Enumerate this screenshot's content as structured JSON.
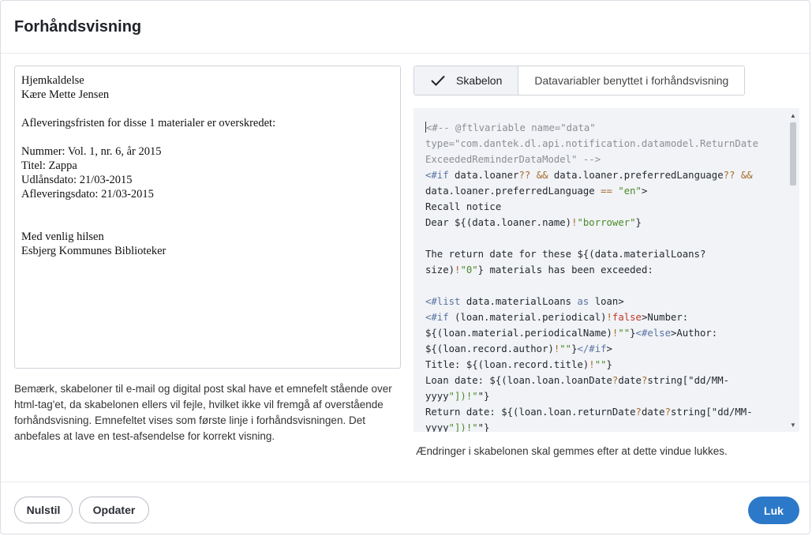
{
  "dialog": {
    "title": "Forhåndsvisning"
  },
  "preview": {
    "lines": [
      "Hjemkaldelse",
      "Kære Mette Jensen",
      "",
      "Afleveringsfristen for disse 1 materialer er overskredet:",
      "",
      "Nummer: Vol. 1, nr. 6, år 2015",
      "Titel: Zappa",
      "Udlånsdato: 21/03-2015",
      "Afleveringsdato: 21/03-2015",
      "",
      "",
      "Med venlig hilsen",
      "Esbjerg Kommunes Biblioteker"
    ]
  },
  "note": "Bemærk, skabeloner til e-mail og digital post skal have et emnefelt stående over html-tag'et, da skabelonen ellers vil fejle, hvilket ikke vil fremgå af overstående forhåndsvisning. Emnefeltet vises som første linje i forhåndsvisningen. Det anbefales at lave en test-afsendelse for korrekt visning.",
  "tabs": [
    {
      "label": "Skabelon",
      "active": true,
      "icon": "check-icon"
    },
    {
      "label": "Datavariabler benyttet i forhåndsvisning",
      "active": false
    }
  ],
  "code_lines": [
    "<#-- @ftlvariable name=\"data\"",
    "type=\"com.dantek.dl.api.notification.datamodel.ReturnDate",
    "ExceededReminderDataModel\" -->",
    "<#if data.loaner?? && data.loaner.preferredLanguage?? &&",
    "data.loaner.preferredLanguage == \"en\">",
    "Recall notice",
    "Dear ${(data.loaner.name)!\"borrower\"}",
    "",
    "The return date for these ${(data.materialLoans?",
    "size)!\"0\"} materials has been exceeded:",
    "",
    "<#list data.materialLoans as loan>",
    "<#if (loan.material.periodical)!false>Number:",
    "${(loan.material.periodicalName)!\"\"}<#else>Author:",
    "${(loan.record.author)!\"\"}</#if>",
    "Title: ${(loan.record.title)!\"\"}",
    "Loan date: ${(loan.loan.loanDate?date?string[\"dd/MM-",
    "yyyy\"])!\"\"}",
    "Return date: ${(loan.loan.returnDate?date?string[\"dd/MM-",
    "yyyy\"])!\"\"}"
  ],
  "save_note": "Ændringer i skabelonen skal gemmes efter at dette vindue lukkes.",
  "buttons": {
    "reset": "Nulstil",
    "update": "Opdater",
    "close": "Luk"
  },
  "colors": {
    "primary": "#2c79c9",
    "code_bg": "#f1f3f6",
    "string": "#4a8a2a",
    "keyword": "#5b73a3",
    "comment": "#8b8f95"
  }
}
